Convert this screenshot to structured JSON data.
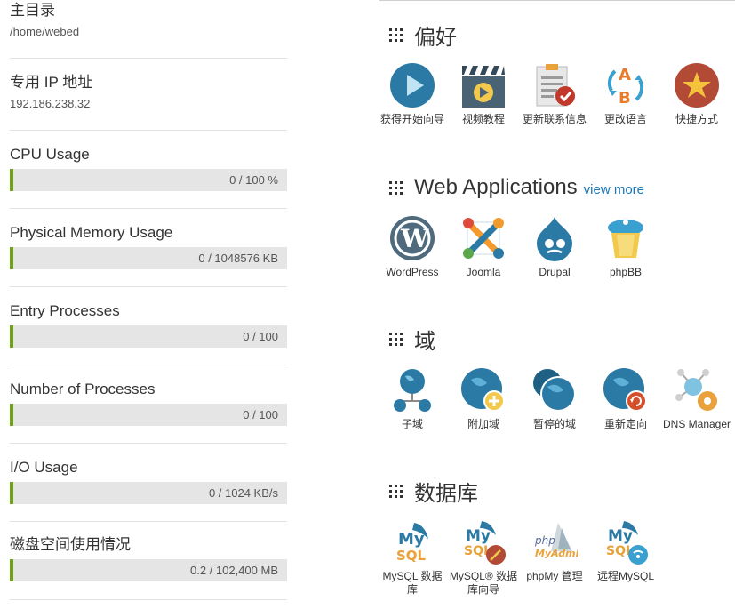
{
  "sidebar": {
    "home_dir": {
      "title": "主目录",
      "value": "/home/webed"
    },
    "dedicated_ip": {
      "title": "专用 IP 地址",
      "value": "192.186.238.32"
    },
    "cpu": {
      "title": "CPU Usage",
      "text": "0 / 100 %",
      "fraction": 0
    },
    "memory": {
      "title": "Physical Memory Usage",
      "text": "0 / 1048576 KB",
      "fraction": 0
    },
    "entry_processes": {
      "title": "Entry Processes",
      "text": "0 / 100",
      "fraction": 0
    },
    "num_processes": {
      "title": "Number of Processes",
      "text": "0 / 100",
      "fraction": 0
    },
    "io": {
      "title": "I/O Usage",
      "text": "0 / 1024 KB/s",
      "fraction": 0
    },
    "disk": {
      "title": "磁盘空间使用情况",
      "text": "0.2 / 102,400 MB",
      "fraction": 0
    }
  },
  "colors": {
    "accent_green": "#6fa315",
    "link_blue": "#1b77b9",
    "icon_blue": "#2b7aa6"
  },
  "sections": {
    "preferences": {
      "title": "偏好",
      "items": [
        {
          "label": "获得开始向导",
          "icon": "play-icon"
        },
        {
          "label": "视频教程",
          "icon": "video-clapper-icon"
        },
        {
          "label": "更新联系信息",
          "icon": "contact-clipboard-icon"
        },
        {
          "label": "更改语言",
          "icon": "language-ab-icon"
        },
        {
          "label": "快捷方式",
          "icon": "star-icon"
        }
      ]
    },
    "web_apps": {
      "title": "Web Applications",
      "view_more": "view more",
      "items": [
        {
          "label": "WordPress",
          "icon": "wordpress-icon"
        },
        {
          "label": "Joomla",
          "icon": "joomla-icon"
        },
        {
          "label": "Drupal",
          "icon": "drupal-icon"
        },
        {
          "label": "phpBB",
          "icon": "phpbb-icon"
        }
      ]
    },
    "domains": {
      "title": "域",
      "items": [
        {
          "label": "子域",
          "icon": "subdomain-icon"
        },
        {
          "label": "附加域",
          "icon": "addon-domain-icon"
        },
        {
          "label": "暂停的域",
          "icon": "parked-domain-icon"
        },
        {
          "label": "重新定向",
          "icon": "redirect-icon"
        },
        {
          "label": "DNS Manager",
          "icon": "dns-manager-icon"
        }
      ]
    },
    "databases": {
      "title": "数据库",
      "items": [
        {
          "label_line1": "MySQL 数据",
          "label_line2": "库",
          "icon": "mysql-icon",
          "logo_top": "My",
          "logo_bottom": "SQL"
        },
        {
          "label_line1": "MySQL® 数据",
          "label_line2": "库向导",
          "icon": "mysql-wizard-icon",
          "logo_top": "My",
          "logo_bottom": "SQL"
        },
        {
          "label_line1": "phpMy 管理",
          "label_line2": "",
          "icon": "phpmyadmin-icon",
          "logo_top": "php",
          "logo_bottom": "MyAdmin"
        },
        {
          "label_line1": "远程MySQL",
          "label_line2": "",
          "icon": "remote-mysql-icon",
          "logo_top": "My",
          "logo_bottom": "SQL"
        }
      ]
    }
  }
}
